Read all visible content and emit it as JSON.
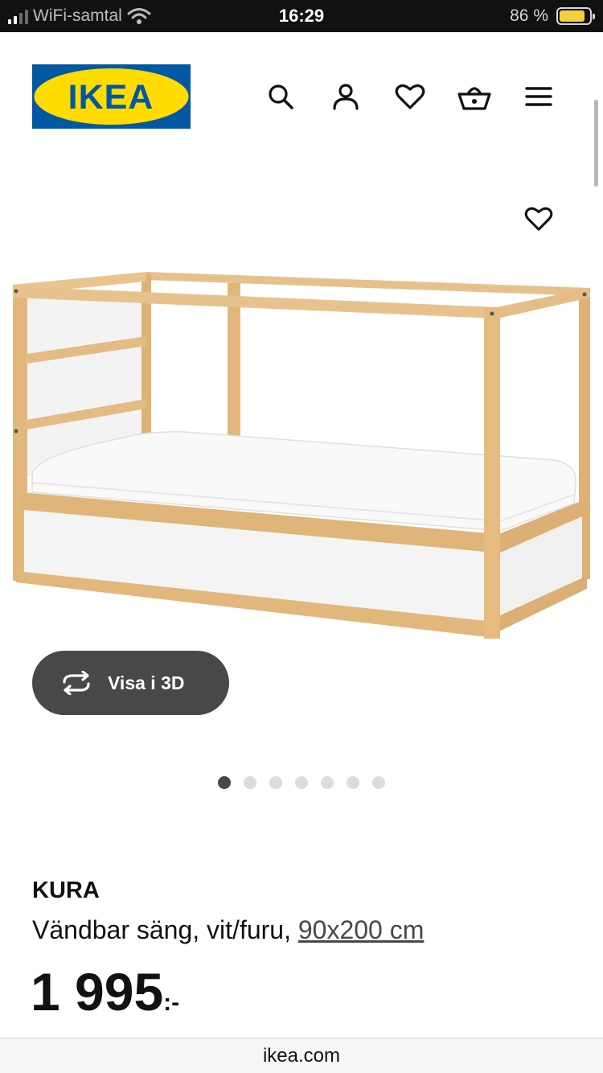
{
  "status_bar": {
    "carrier": "WiFi-samtal",
    "time": "16:29",
    "battery_percent": "86 %",
    "battery_level": 0.86,
    "signal_bars_on": 2
  },
  "header": {
    "logo_text": "IKEA",
    "icons": [
      "close-icon",
      "search-icon",
      "account-icon",
      "heart-icon",
      "basket-icon",
      "menu-icon"
    ]
  },
  "gallery": {
    "view_3d_label": "Visa i 3D",
    "image_count": 7,
    "active_index": 0
  },
  "product": {
    "name": "KURA",
    "description": "Vändbar säng, vit/furu,",
    "size_link": "90x200 cm",
    "price": "1 995",
    "price_suffix": ":-"
  },
  "browser": {
    "url": "ikea.com"
  },
  "colors": {
    "ikea_blue": "#0058a3",
    "ikea_yellow": "#ffdb00",
    "button_dark": "#484848",
    "pine": "#e2b77c",
    "status_bar_bg": "#111111"
  }
}
